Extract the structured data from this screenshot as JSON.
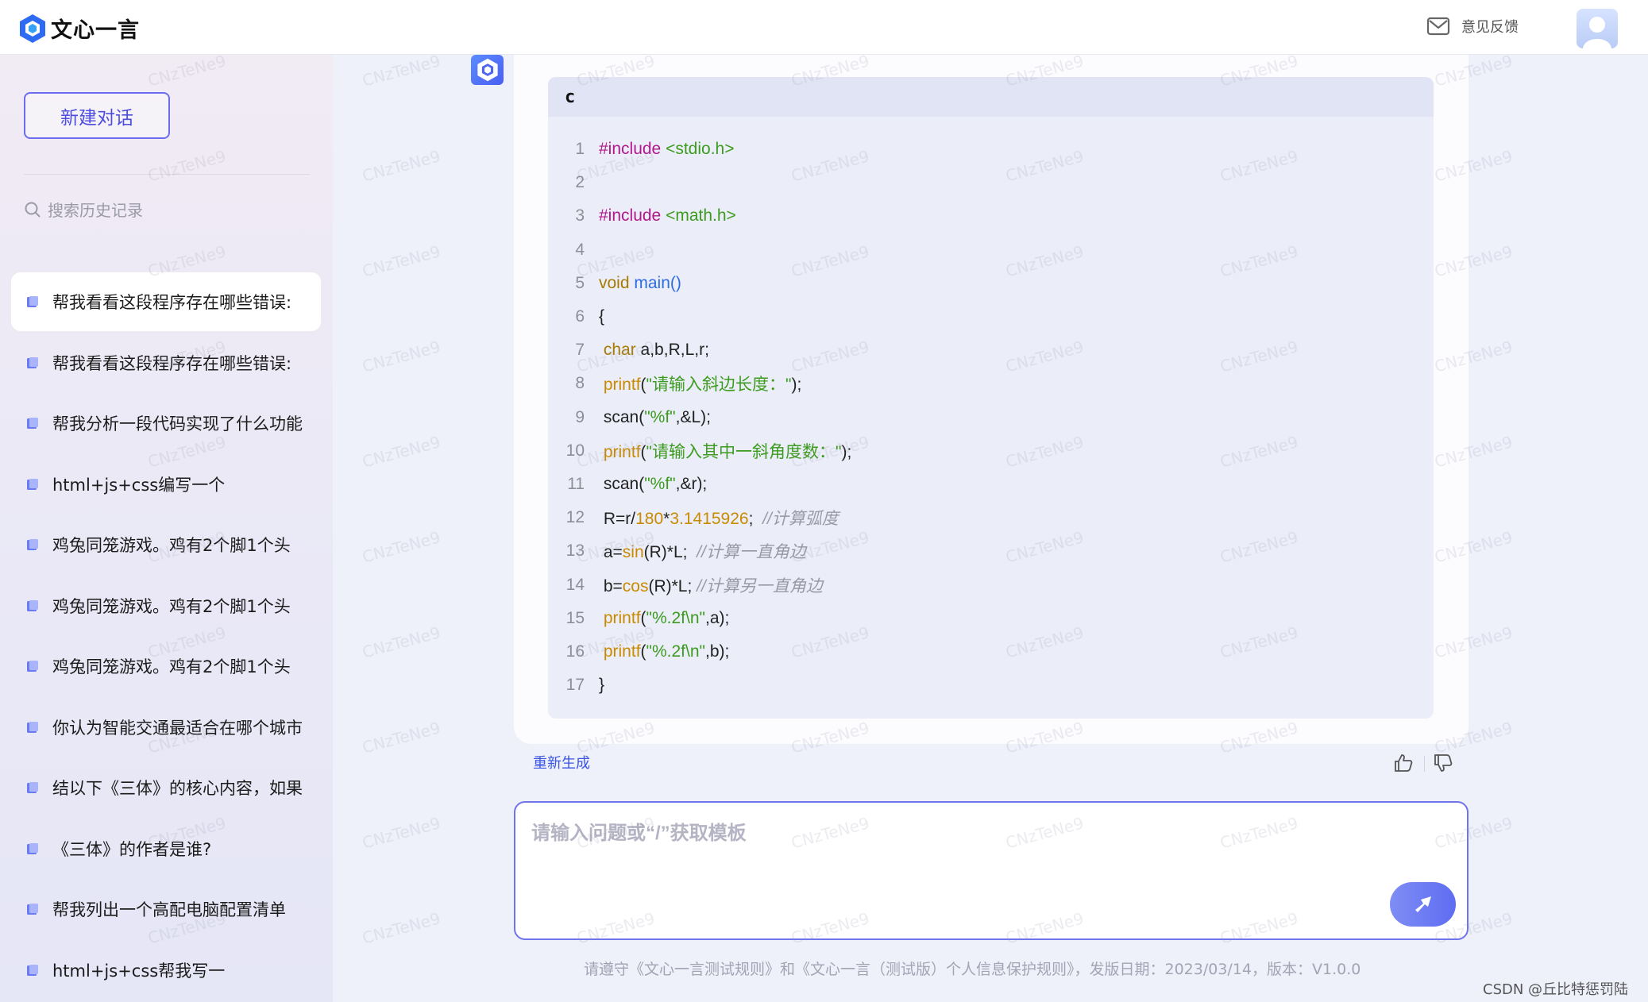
{
  "app": {
    "name": "文心一言"
  },
  "header": {
    "feedback_label": "意见反馈"
  },
  "sidebar": {
    "new_chat_label": "新建对话",
    "search_placeholder": "搜索历史记录",
    "history": [
      {
        "label": "帮我看看这段程序存在哪些错误:",
        "active": true
      },
      {
        "label": "帮我看看这段程序存在哪些错误:"
      },
      {
        "label": "帮我分析一段代码实现了什么功能"
      },
      {
        "label": "html+js+css编写一个"
      },
      {
        "label": "鸡兔同笼游戏。鸡有2个脚1个头"
      },
      {
        "label": "鸡兔同笼游戏。鸡有2个脚1个头"
      },
      {
        "label": "鸡兔同笼游戏。鸡有2个脚1个头"
      },
      {
        "label": "你认为智能交通最适合在哪个城市"
      },
      {
        "label": "结以下《三体》的核心内容，如果"
      },
      {
        "label": "《三体》的作者是谁?"
      },
      {
        "label": "帮我列出一个高配电脑配置清单"
      },
      {
        "label": "html+js+css帮我写一"
      }
    ]
  },
  "code": {
    "language": "c",
    "lines": [
      {
        "n": "1",
        "tokens": [
          [
            "#include",
            "kw"
          ],
          [
            " ",
            ""
          ],
          [
            "<stdio.h>",
            "str"
          ]
        ]
      },
      {
        "n": "2",
        "tokens": []
      },
      {
        "n": "3",
        "tokens": [
          [
            "#include",
            "kw"
          ],
          [
            " ",
            ""
          ],
          [
            "<math.h>",
            "str"
          ]
        ]
      },
      {
        "n": "4",
        "tokens": []
      },
      {
        "n": "5",
        "tokens": [
          [
            "void",
            "type"
          ],
          [
            " ",
            ""
          ],
          [
            "main()",
            "fn"
          ]
        ]
      },
      {
        "n": "6",
        "tokens": [
          [
            "{",
            ""
          ]
        ]
      },
      {
        "n": "7",
        "tokens": [
          [
            " ",
            ""
          ],
          [
            "char",
            "type"
          ],
          [
            " a,b,R,L,r;",
            ""
          ]
        ]
      },
      {
        "n": "8",
        "tokens": [
          [
            " ",
            ""
          ],
          [
            "printf",
            "call"
          ],
          [
            "(",
            ""
          ],
          [
            "\"请输入斜边长度：\"",
            "str"
          ],
          [
            ");",
            ""
          ]
        ]
      },
      {
        "n": "9",
        "tokens": [
          [
            " scan(",
            ""
          ],
          [
            "\"%f\"",
            "str"
          ],
          [
            ",&L);",
            ""
          ]
        ]
      },
      {
        "n": "10",
        "tokens": [
          [
            " ",
            ""
          ],
          [
            "printf",
            "call"
          ],
          [
            "(",
            ""
          ],
          [
            "\"请输入其中一斜角度数：\"",
            "str"
          ],
          [
            ");",
            ""
          ]
        ]
      },
      {
        "n": "11",
        "tokens": [
          [
            " scan(",
            ""
          ],
          [
            "\"%f\"",
            "str"
          ],
          [
            ",&r);",
            ""
          ]
        ]
      },
      {
        "n": "12",
        "tokens": [
          [
            " R=r/",
            ""
          ],
          [
            "180",
            "num"
          ],
          [
            "*",
            ""
          ],
          [
            "3.1415926",
            "num"
          ],
          [
            ";  ",
            ""
          ],
          [
            "//计算弧度",
            "cmt"
          ]
        ]
      },
      {
        "n": "13",
        "tokens": [
          [
            " a=",
            ""
          ],
          [
            "sin",
            "call"
          ],
          [
            "(R)*L;  ",
            ""
          ],
          [
            "//计算一直角边",
            "cmt"
          ]
        ]
      },
      {
        "n": "14",
        "tokens": [
          [
            " b=",
            ""
          ],
          [
            "cos",
            "call"
          ],
          [
            "(R)*L; ",
            ""
          ],
          [
            "//计算另一直角边",
            "cmt"
          ]
        ]
      },
      {
        "n": "15",
        "tokens": [
          [
            " ",
            ""
          ],
          [
            "printf",
            "call"
          ],
          [
            "(",
            ""
          ],
          [
            "\"%.2f\\n\"",
            "str"
          ],
          [
            ",a);",
            ""
          ]
        ]
      },
      {
        "n": "16",
        "tokens": [
          [
            " ",
            ""
          ],
          [
            "printf",
            "call"
          ],
          [
            "(",
            ""
          ],
          [
            "\"%.2f\\n\"",
            "str"
          ],
          [
            ",b);",
            ""
          ]
        ]
      },
      {
        "n": "17",
        "tokens": [
          [
            "}",
            ""
          ]
        ]
      }
    ]
  },
  "actions": {
    "regenerate_label": "重新生成"
  },
  "input": {
    "placeholder": "请输入问题或“/”获取模板"
  },
  "footer": {
    "text": "请遵守《文心一言测试规则》和《文心一言（测试版）个人信息保护规则》，发版日期：2023/03/14，版本：V1.0.0"
  },
  "watermark": {
    "text": "CNzTeNe9",
    "source_label": "CSDN @丘比特惩罚陆"
  },
  "colors": {
    "kw": "#b0188c",
    "str": "#3d9b1f",
    "type": "#a77a00",
    "fn": "#2d6be0",
    "call": "#c98a00",
    "num": "#c98a00",
    "cmt": "#9a9aa6",
    "accent": "#5b5ef0"
  }
}
